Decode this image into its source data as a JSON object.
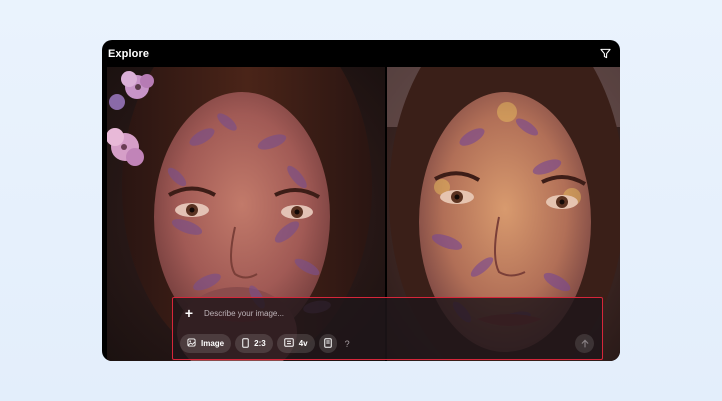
{
  "window": {
    "title": "Explore"
  },
  "icons": {
    "filter": "filter-icon",
    "plus": "plus-icon",
    "image": "image-icon",
    "aspect": "portrait-rectangle-icon",
    "versions": "versions-icon",
    "style": "book-icon",
    "send": "arrow-up-icon"
  },
  "gallery": {
    "images": [
      {
        "name": "portrait-with-flowers-and-leaf-shadows"
      },
      {
        "name": "portrait-with-golden-leaf-shadows"
      }
    ]
  },
  "prompt": {
    "plus_label": "+",
    "placeholder": "Describe your image...",
    "mode_label": "Image",
    "aspect_label": "2:3",
    "versions_label": "4v",
    "help_label": "?"
  },
  "colors": {
    "highlight_border": "#d6263a",
    "window_bg": "#000000",
    "page_bg": "#e6f0fc"
  }
}
